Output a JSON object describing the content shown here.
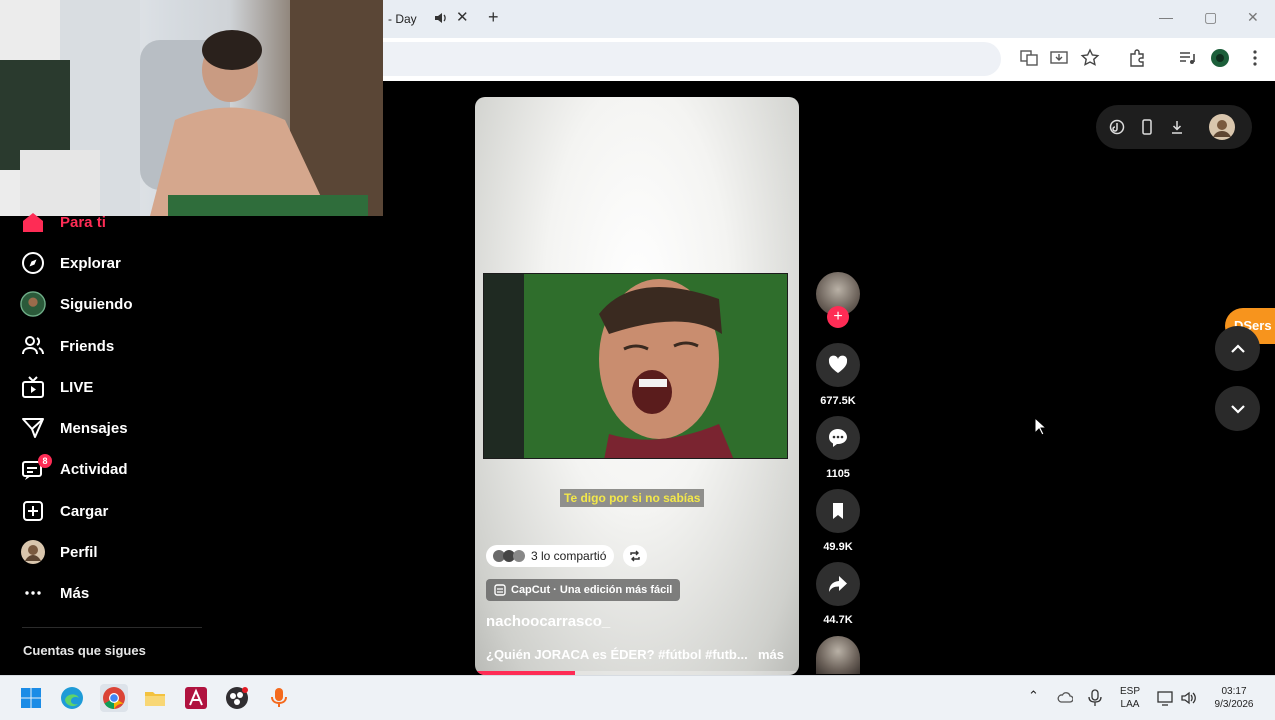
{
  "browser": {
    "tab_title": "- Day",
    "new_tab_label": "+",
    "window_controls": {
      "minimize": "—",
      "maximize": "▢",
      "close": "✕"
    }
  },
  "sidebar": {
    "items": [
      {
        "label": "Para ti",
        "icon": "home-icon",
        "active": true
      },
      {
        "label": "Explorar",
        "icon": "compass-icon"
      },
      {
        "label": "Siguiendo",
        "icon": "following-avatar-icon"
      },
      {
        "label": "Friends",
        "icon": "friends-icon"
      },
      {
        "label": "LIVE",
        "icon": "live-icon"
      },
      {
        "label": "Mensajes",
        "icon": "send-icon"
      },
      {
        "label": "Actividad",
        "icon": "activity-icon",
        "badge": "8"
      },
      {
        "label": "Cargar",
        "icon": "upload-icon"
      },
      {
        "label": "Perfil",
        "icon": "profile-avatar-icon"
      },
      {
        "label": "Más",
        "icon": "more-dots-icon"
      }
    ],
    "following_title": "Cuentas que sigues"
  },
  "video": {
    "subtitle": "Te digo por si no sabías",
    "shared": "3 lo compartió",
    "effect_label": "CapCut · Una edición más fácil",
    "author": "nachoocarrasco_",
    "caption": "¿Quién JORACA es ÉDER? #fútbol #futb...",
    "more": "más",
    "progress": 0.31
  },
  "actions": {
    "likes": "677.5K",
    "comments": "1105",
    "saves": "49.9K",
    "shares": "44.7K"
  },
  "extension": {
    "dsers_label": "DSers"
  },
  "taskbar": {
    "language_top": "ESP",
    "language_bottom": "LAA",
    "time": "03:17",
    "date": "9/3/2026"
  },
  "colors": {
    "accent": "#fe2c55",
    "dsers": "#f7941d"
  }
}
